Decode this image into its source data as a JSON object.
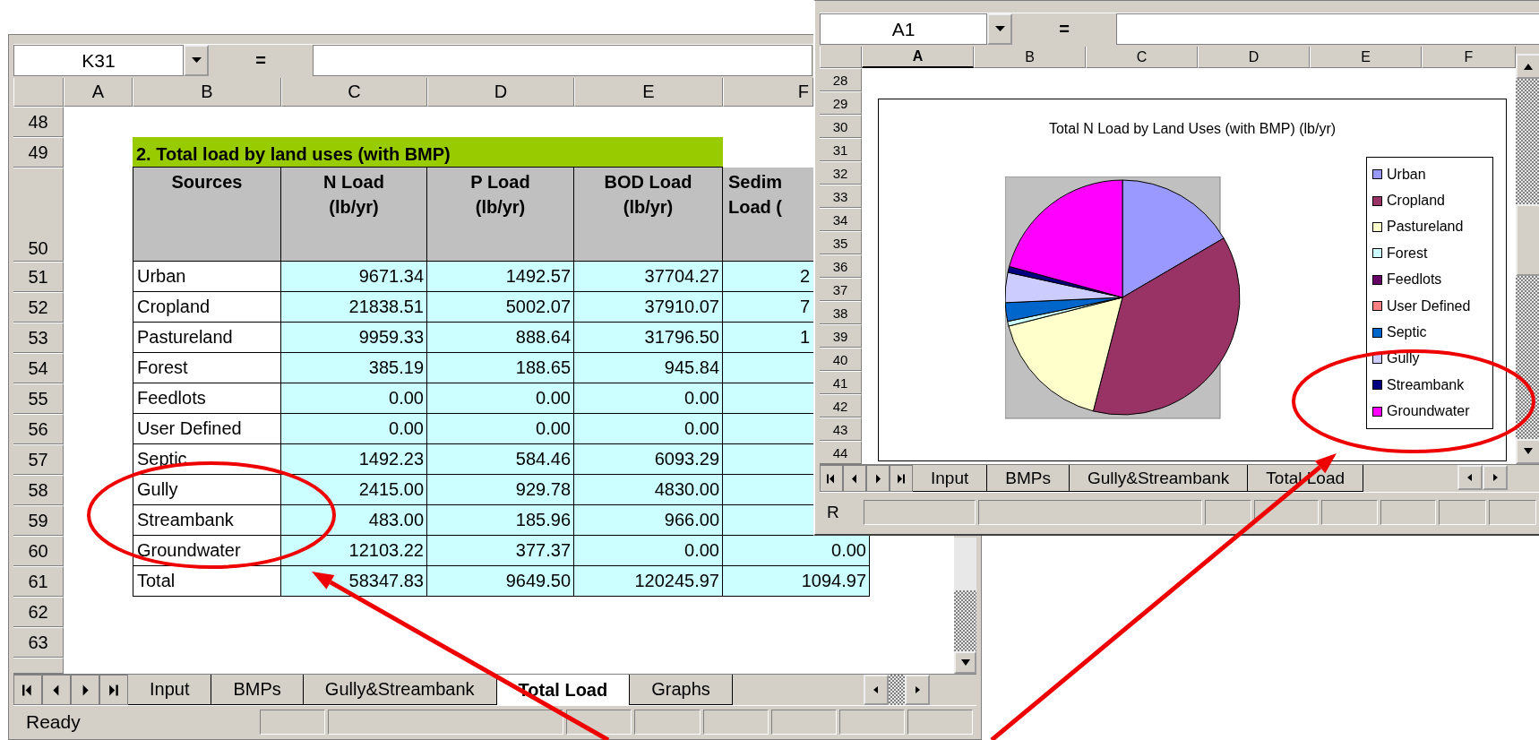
{
  "left_window": {
    "name_box": "K31",
    "formula_symbol": "=",
    "columns": [
      {
        "label": "A",
        "selected": false
      },
      {
        "label": "B",
        "selected": false
      },
      {
        "label": "C",
        "selected": false
      },
      {
        "label": "D",
        "selected": false
      },
      {
        "label": "E",
        "selected": false
      },
      {
        "label": "F",
        "selected": false
      }
    ],
    "rows": [
      {
        "number": "48",
        "kind": "blank"
      },
      {
        "number": "49",
        "kind": "title",
        "text": "2. Total load by land uses (with BMP)"
      },
      {
        "number": "50",
        "kind": "header",
        "headers": [
          [
            "Sources"
          ],
          [
            "N Load",
            "(lb/yr)"
          ],
          [
            "P Load",
            "(lb/yr)"
          ],
          [
            "BOD Load",
            "(lb/yr)"
          ],
          [
            "Sedim",
            "Load ("
          ]
        ]
      },
      {
        "number": "51",
        "kind": "data",
        "cells": [
          "Urban",
          "9671.34",
          "1492.57",
          "37704.27",
          "2"
        ]
      },
      {
        "number": "52",
        "kind": "data",
        "cells": [
          "Cropland",
          "21838.51",
          "5002.07",
          "37910.07",
          "7"
        ]
      },
      {
        "number": "53",
        "kind": "data",
        "cells": [
          "Pastureland",
          "9959.33",
          "888.64",
          "31796.50",
          "1"
        ]
      },
      {
        "number": "54",
        "kind": "data",
        "cells": [
          "Forest",
          "385.19",
          "188.65",
          "945.84"
        ]
      },
      {
        "number": "55",
        "kind": "data",
        "cells": [
          "Feedlots",
          "0.00",
          "0.00",
          "0.00"
        ]
      },
      {
        "number": "56",
        "kind": "data",
        "cells": [
          "User Defined",
          "0.00",
          "0.00",
          "0.00"
        ]
      },
      {
        "number": "57",
        "kind": "data",
        "cells": [
          "Septic",
          "1492.23",
          "584.46",
          "6093.29"
        ]
      },
      {
        "number": "58",
        "kind": "data",
        "cells": [
          "Gully",
          "2415.00",
          "929.78",
          "4830.00"
        ]
      },
      {
        "number": "59",
        "kind": "data",
        "cells": [
          "Streambank",
          "483.00",
          "185.96",
          "966.00"
        ]
      },
      {
        "number": "60",
        "kind": "data",
        "cells": [
          "Groundwater",
          "12103.22",
          "377.37",
          "0.00",
          "0.00"
        ]
      },
      {
        "number": "61",
        "kind": "data",
        "cells": [
          "Total",
          "58347.83",
          "9649.50",
          "120245.97",
          "1094.97"
        ]
      },
      {
        "number": "62",
        "kind": "blank"
      },
      {
        "number": "63",
        "kind": "blank"
      }
    ],
    "sheet_tabs": [
      {
        "label": "Input",
        "selected": false
      },
      {
        "label": "BMPs",
        "selected": false
      },
      {
        "label": "Gully&Streambank",
        "selected": false
      },
      {
        "label": "Total Load",
        "selected": true
      },
      {
        "label": "Graphs",
        "selected": false
      }
    ],
    "status": "Ready"
  },
  "right_window": {
    "name_box": "A1",
    "formula_symbol": "=",
    "columns": [
      {
        "label": "A",
        "selected": true
      },
      {
        "label": "B",
        "selected": false
      },
      {
        "label": "C",
        "selected": false
      },
      {
        "label": "D",
        "selected": false
      },
      {
        "label": "E",
        "selected": false
      },
      {
        "label": "F",
        "selected": false
      }
    ],
    "row_numbers": [
      "28",
      "29",
      "30",
      "31",
      "32",
      "33",
      "34",
      "35",
      "36",
      "37",
      "38",
      "39",
      "40",
      "41",
      "42",
      "43",
      "44"
    ],
    "chart": {
      "chart_data": {
        "type": "pie",
        "title": "Total N Load by Land Uses (with BMP) (lb/yr)",
        "categories": [
          "Urban",
          "Cropland",
          "Pastureland",
          "Forest",
          "Feedlots",
          "User Defined",
          "Septic",
          "Gully",
          "Streambank",
          "Groundwater"
        ],
        "values": [
          16.575,
          37.428,
          17.069,
          0.66,
          0,
          0,
          2.557,
          4.139,
          0.828,
          20.744
        ]
      },
      "legend": [
        {
          "color": "#9999ff"
        },
        {
          "color": "#993366"
        },
        {
          "color": "#ffffcc"
        },
        {
          "color": "#ccffff"
        },
        {
          "color": "#660066"
        },
        {
          "color": "#ff8080"
        },
        {
          "color": "#0066cc"
        },
        {
          "color": "#ccccff"
        },
        {
          "color": "#000080"
        },
        {
          "color": "#ff00ff"
        }
      ]
    },
    "sheet_tabs": [
      {
        "label": "Input",
        "selected": false
      },
      {
        "label": "BMPs",
        "selected": false
      },
      {
        "label": "Gully&Streambank",
        "selected": false
      },
      {
        "label": "Total Load",
        "selected": false
      }
    ],
    "status": "R"
  },
  "annotations": [
    {
      "kind": "ellipse"
    },
    {
      "kind": "ellipse"
    },
    {
      "kind": "arrow"
    },
    {
      "kind": "arrow"
    }
  ]
}
